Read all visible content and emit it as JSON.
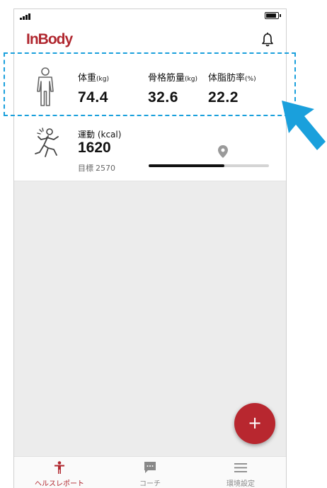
{
  "app": {
    "logo_text": "InBody",
    "brand_color": "#b0272f"
  },
  "body_card": {
    "metrics": [
      {
        "label": "体重",
        "unit": "(kg)",
        "value": "74.4"
      },
      {
        "label": "骨格筋量",
        "unit": "(kg)",
        "value": "32.6"
      },
      {
        "label": "体脂肪率",
        "unit": "(%)",
        "value": "22.2"
      }
    ]
  },
  "exercise_card": {
    "label": "運動 (kcal)",
    "value": "1620",
    "goal_label": "目標",
    "goal_value": "2570",
    "progress": 0.63
  },
  "tabs": [
    {
      "label": "ヘルスレポート",
      "icon": "person-icon",
      "active": true
    },
    {
      "label": "コーチ",
      "icon": "chat-icon",
      "active": false
    },
    {
      "label": "環境設定",
      "icon": "menu-icon",
      "active": false
    }
  ],
  "fab": {
    "label": "+"
  },
  "annotation_color": "#1aa0dc"
}
